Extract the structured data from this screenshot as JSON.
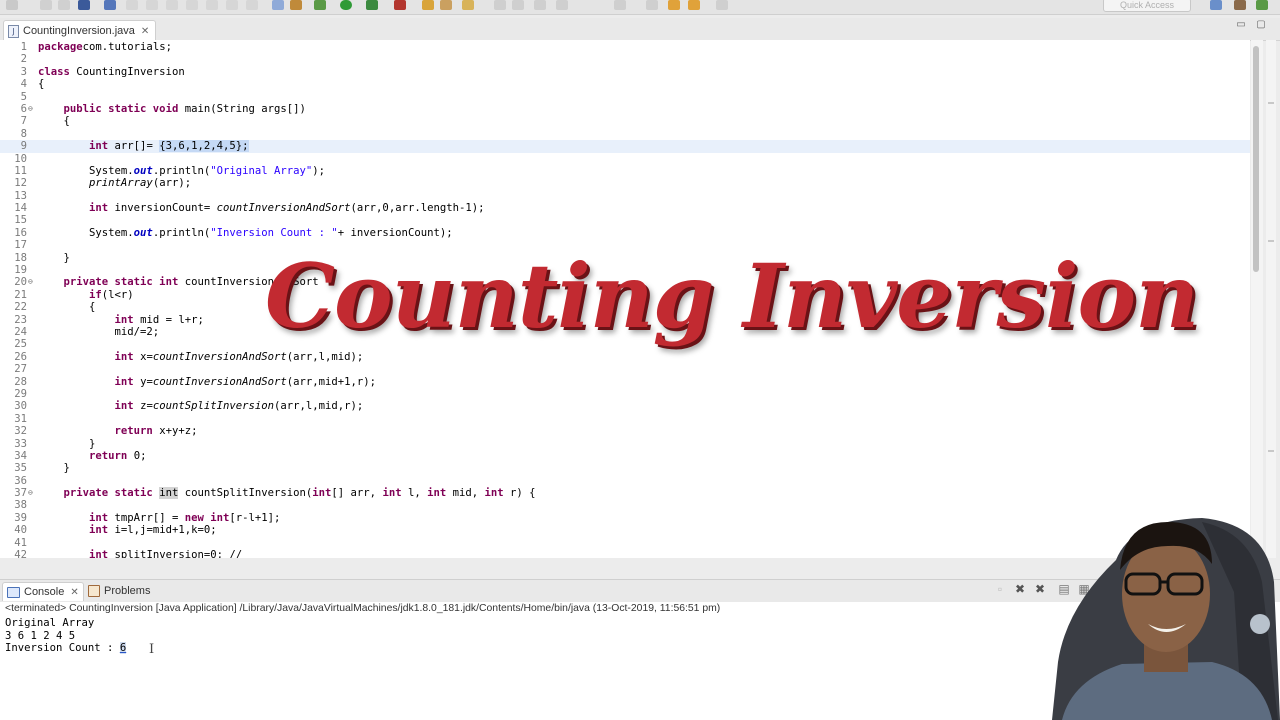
{
  "toolbar": {
    "quick_access": "Quick Access"
  },
  "editor": {
    "tab_title": "CountingInversion.java",
    "lines": [
      {
        "n": "1",
        "parts": [
          [
            "kw",
            "package"
          ],
          [
            "",
            "com.tutorials;"
          ]
        ]
      },
      {
        "n": "2",
        "parts": []
      },
      {
        "n": "3",
        "parts": [
          [
            "kw",
            "class"
          ],
          [
            "",
            " CountingInversion"
          ]
        ]
      },
      {
        "n": "4",
        "parts": [
          [
            "",
            "{"
          ]
        ]
      },
      {
        "n": "5",
        "parts": []
      },
      {
        "n": "6",
        "fold": true,
        "parts": [
          [
            "",
            "    "
          ],
          [
            "kw",
            "public static void"
          ],
          [
            "",
            " main(String args[])"
          ]
        ]
      },
      {
        "n": "7",
        "parts": [
          [
            "",
            "    {"
          ]
        ]
      },
      {
        "n": "8",
        "parts": []
      },
      {
        "n": "9",
        "hl": true,
        "parts": [
          [
            "",
            "        "
          ],
          [
            "kw",
            "int"
          ],
          [
            "",
            " arr[]= "
          ],
          [
            "sel",
            "{3,6,1,2,4,5};"
          ]
        ]
      },
      {
        "n": "10",
        "parts": []
      },
      {
        "n": "11",
        "parts": [
          [
            "",
            "        System."
          ],
          [
            "fld",
            "out"
          ],
          [
            "",
            ".println("
          ],
          [
            "st",
            "\"Original Array\""
          ],
          [
            "",
            ");"
          ]
        ]
      },
      {
        "n": "12",
        "parts": [
          [
            "",
            "        "
          ],
          [
            "mt",
            "printArray"
          ],
          [
            "",
            "(arr);"
          ]
        ]
      },
      {
        "n": "13",
        "parts": []
      },
      {
        "n": "14",
        "parts": [
          [
            "",
            "        "
          ],
          [
            "kw",
            "int"
          ],
          [
            "",
            " inversionCount= "
          ],
          [
            "mt",
            "countInversionAndSort"
          ],
          [
            "",
            "(arr,0,arr.length-1);"
          ]
        ]
      },
      {
        "n": "15",
        "parts": []
      },
      {
        "n": "16",
        "parts": [
          [
            "",
            "        System."
          ],
          [
            "fld",
            "out"
          ],
          [
            "",
            ".println("
          ],
          [
            "st",
            "\"Inversion Count : \""
          ],
          [
            "",
            "+ inversionCount);"
          ]
        ]
      },
      {
        "n": "17",
        "parts": []
      },
      {
        "n": "18",
        "parts": [
          [
            "",
            "    }"
          ]
        ]
      },
      {
        "n": "19",
        "parts": []
      },
      {
        "n": "20",
        "fold": true,
        "parts": [
          [
            "",
            "    "
          ],
          [
            "kw",
            "private static int"
          ],
          [
            "",
            " countInversionAndSort"
          ]
        ]
      },
      {
        "n": "21",
        "parts": [
          [
            "",
            "        "
          ],
          [
            "kw",
            "if"
          ],
          [
            "",
            "(l<r)"
          ]
        ]
      },
      {
        "n": "22",
        "parts": [
          [
            "",
            "        {"
          ]
        ]
      },
      {
        "n": "23",
        "parts": [
          [
            "",
            "            "
          ],
          [
            "kw",
            "int"
          ],
          [
            "",
            " mid = l+r;"
          ]
        ]
      },
      {
        "n": "24",
        "parts": [
          [
            "",
            "            mid/=2;"
          ]
        ]
      },
      {
        "n": "25",
        "parts": []
      },
      {
        "n": "26",
        "parts": [
          [
            "",
            "            "
          ],
          [
            "kw",
            "int"
          ],
          [
            "",
            " x="
          ],
          [
            "mt",
            "countInversionAndSort"
          ],
          [
            "",
            "(arr,l,mid);"
          ]
        ]
      },
      {
        "n": "27",
        "parts": []
      },
      {
        "n": "28",
        "parts": [
          [
            "",
            "            "
          ],
          [
            "kw",
            "int"
          ],
          [
            "",
            " y="
          ],
          [
            "mt",
            "countInversionAndSort"
          ],
          [
            "",
            "(arr,mid+1,r);"
          ]
        ]
      },
      {
        "n": "29",
        "parts": []
      },
      {
        "n": "30",
        "parts": [
          [
            "",
            "            "
          ],
          [
            "kw",
            "int"
          ],
          [
            "",
            " z="
          ],
          [
            "mt",
            "countSplitInversion"
          ],
          [
            "",
            "(arr,l,mid,r);"
          ]
        ]
      },
      {
        "n": "31",
        "parts": []
      },
      {
        "n": "32",
        "parts": [
          [
            "",
            "            "
          ],
          [
            "kw",
            "return"
          ],
          [
            "",
            " x+y+z;"
          ]
        ]
      },
      {
        "n": "33",
        "parts": [
          [
            "",
            "        }"
          ]
        ]
      },
      {
        "n": "34",
        "parts": [
          [
            "",
            "        "
          ],
          [
            "kw",
            "return"
          ],
          [
            "",
            " 0;"
          ]
        ]
      },
      {
        "n": "35",
        "parts": [
          [
            "",
            "    }"
          ]
        ]
      },
      {
        "n": "36",
        "parts": []
      },
      {
        "n": "37",
        "fold": true,
        "parts": [
          [
            "",
            "    "
          ],
          [
            "kw",
            "private static "
          ],
          [
            "mark",
            "int"
          ],
          [
            "",
            " countSplitInversion("
          ],
          [
            "kw",
            "int"
          ],
          [
            "",
            "[] arr, "
          ],
          [
            "kw",
            "int"
          ],
          [
            "",
            " l, "
          ],
          [
            "kw",
            "int"
          ],
          [
            "",
            " mid, "
          ],
          [
            "kw",
            "int"
          ],
          [
            "",
            " r) {"
          ]
        ]
      },
      {
        "n": "38",
        "parts": []
      },
      {
        "n": "39",
        "parts": [
          [
            "",
            "        "
          ],
          [
            "kw",
            "int"
          ],
          [
            "",
            " tmpArr[] = "
          ],
          [
            "kw",
            "new int"
          ],
          [
            "",
            "[r-l+1];"
          ]
        ]
      },
      {
        "n": "40",
        "parts": [
          [
            "",
            "        "
          ],
          [
            "kw",
            "int"
          ],
          [
            "",
            " i=l,j=mid+1,k=0;"
          ]
        ]
      },
      {
        "n": "41",
        "parts": []
      },
      {
        "n": "42",
        "parts": [
          [
            "",
            "        "
          ],
          [
            "kw",
            "int"
          ],
          [
            "",
            " splitInversion=0; //"
          ]
        ]
      }
    ]
  },
  "overlay_title": "Counting Inversion",
  "bottom_panel": {
    "console_tab": "Console",
    "problems_tab": "Problems"
  },
  "console": {
    "header": "<terminated> CountingInversion [Java Application] /Library/Java/JavaVirtualMachines/jdk1.8.0_181.jdk/Contents/Home/bin/java (13-Oct-2019, 11:56:51 pm)",
    "line1": "Original Array",
    "line2": "3 6 1 2 4 5",
    "line3_prefix": "Inversion Count : ",
    "line3_value": "6"
  },
  "colors": {
    "keyword": "#7f0055",
    "string": "#2a00ff",
    "field": "#0000c0",
    "overlay_red": "#c22a31"
  }
}
